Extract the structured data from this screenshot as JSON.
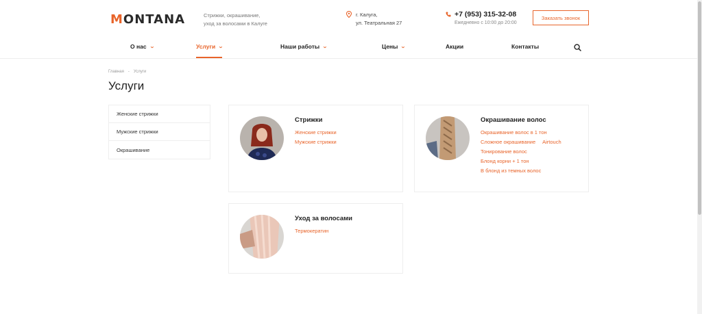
{
  "header": {
    "logo_text": "MONTANA",
    "tagline_line1": "Стрижки, окрашивание,",
    "tagline_line2": "уход за волосами в Калуге",
    "address_line1": "г. Калуга,",
    "address_line2": "ул. Театральная 27",
    "phone": "+7 (953) 315-32-08",
    "hours": "Ежедневно с 10:00 до 20:00",
    "call_button": "Заказать звонок"
  },
  "nav": {
    "items": [
      {
        "label": "О нас",
        "has_dropdown": true
      },
      {
        "label": "Услуги",
        "has_dropdown": true,
        "active": true
      },
      {
        "label": "Наши работы",
        "has_dropdown": true
      },
      {
        "label": "Цены",
        "has_dropdown": true
      },
      {
        "label": "Акции",
        "has_dropdown": false
      },
      {
        "label": "Контакты",
        "has_dropdown": false
      }
    ],
    "search_icon": "search-icon"
  },
  "breadcrumb": {
    "home": "Главная",
    "separator": "-",
    "current": "Услуги"
  },
  "page_title": "Услуги",
  "sidebar": {
    "items": [
      {
        "label": "Женские стрижки"
      },
      {
        "label": "Мужские стрижки"
      },
      {
        "label": "Окрашивание"
      }
    ]
  },
  "cards": {
    "haircuts": {
      "title": "Стрижки",
      "links": [
        "Женские стрижки",
        "Мужские стрижки"
      ]
    },
    "coloring": {
      "title": "Окрашивание волос",
      "links": [
        "Окрашивание волос в 1 тон",
        "Сложное окрашивание",
        "Airtouch",
        "Тонирование волос",
        "Блонд корни + 1 тон",
        "В блонд из темных волос"
      ]
    },
    "care": {
      "title": "Уход за волосами",
      "links": [
        "Термокератин"
      ]
    }
  },
  "colors": {
    "accent": "#e8642a",
    "text": "#222222",
    "border": "#eeeeee"
  }
}
